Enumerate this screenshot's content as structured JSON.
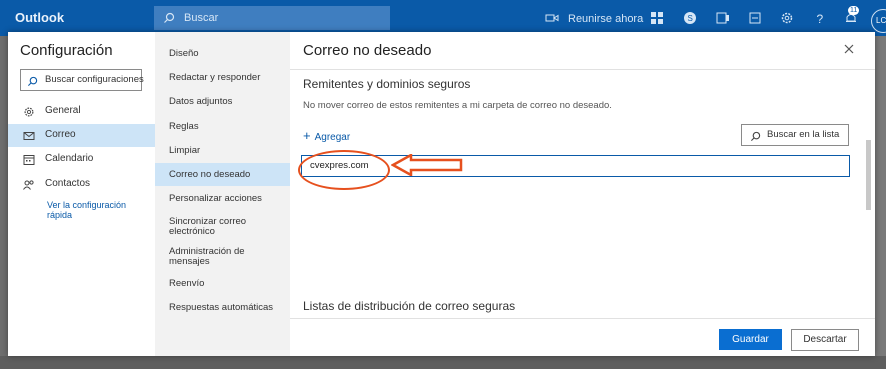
{
  "topbar": {
    "app_name": "Outlook",
    "search_placeholder": "Buscar",
    "meet_now_label": "Reunirse ahora",
    "notifications_count": "11",
    "avatar_initials": "LC",
    "colors": {
      "bar": "#0a5aa8",
      "search": "#3f7ec0"
    }
  },
  "settings_nav": {
    "title": "Configuración",
    "search_placeholder": "Buscar configuraciones",
    "items": [
      {
        "label": "General",
        "icon": "gear-icon",
        "active": false
      },
      {
        "label": "Correo",
        "icon": "mail-icon",
        "active": true
      },
      {
        "label": "Calendario",
        "icon": "calendar-icon",
        "active": false
      },
      {
        "label": "Contactos",
        "icon": "people-icon",
        "active": false
      }
    ],
    "quick_settings_link": "Ver la configuración rápida"
  },
  "mail_nav": {
    "items": [
      {
        "label": "Diseño",
        "active": false
      },
      {
        "label": "Redactar y responder",
        "active": false
      },
      {
        "label": "Datos adjuntos",
        "active": false
      },
      {
        "label": "Reglas",
        "active": false
      },
      {
        "label": "Limpiar",
        "active": false
      },
      {
        "label": "Correo no deseado",
        "active": true
      },
      {
        "label": "Personalizar acciones",
        "active": false
      },
      {
        "label": "Sincronizar correo electrónico",
        "active": false
      },
      {
        "label": "Administración de mensajes",
        "active": false
      },
      {
        "label": "Reenvío",
        "active": false
      },
      {
        "label": "Respuestas automáticas",
        "active": false
      }
    ]
  },
  "main": {
    "title": "Correo no deseado",
    "safe_senders": {
      "heading": "Remitentes y dominios seguros",
      "description": "No mover correo de estos remitentes a mi carpeta de correo no deseado.",
      "add_label": "Agregar",
      "list_search_placeholder": "Buscar en la lista",
      "entry_value": "cvexpres.com"
    },
    "safe_lists_heading": "Listas de distribución de correo seguras",
    "save_label": "Guardar",
    "discard_label": "Descartar",
    "colors": {
      "accent": "#0a6ed1",
      "active_nav": "#cde4f7",
      "callout": "#e6501e"
    }
  }
}
